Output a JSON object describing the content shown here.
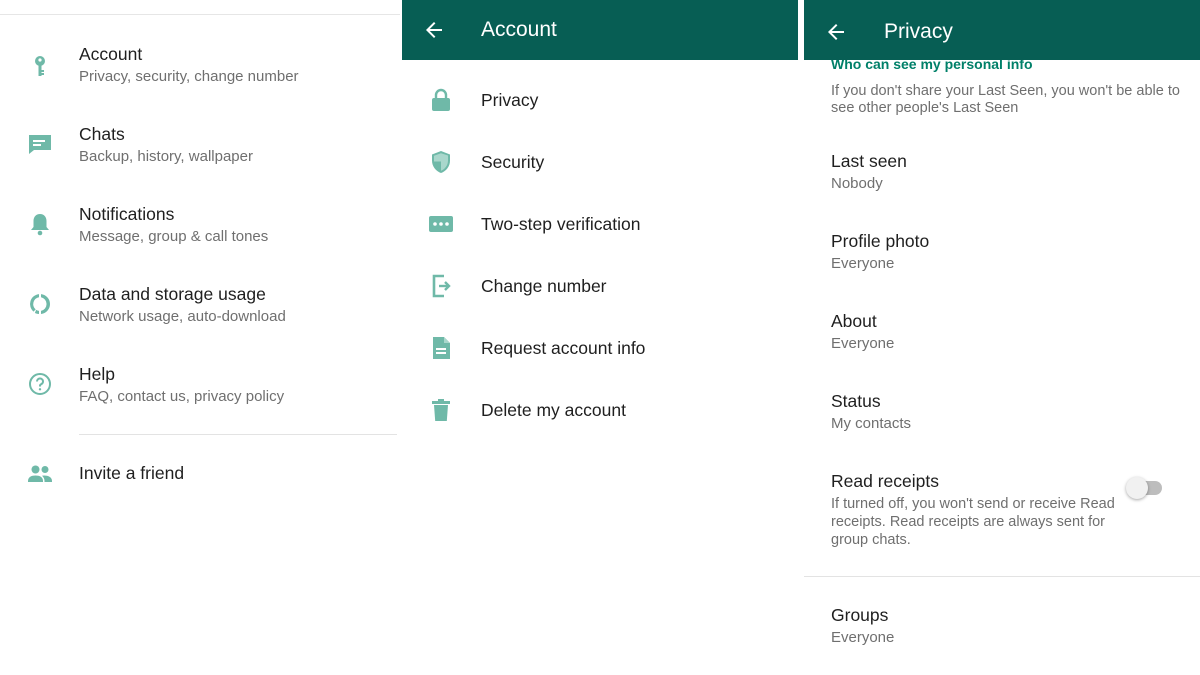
{
  "colors": {
    "accent": "#008069",
    "icon_gray_green": "#6fb9a8",
    "appbar": "#075e54",
    "toggle_off": "#bdbdbd"
  },
  "settings": {
    "items": [
      {
        "title": "Account",
        "subtitle": "Privacy, security, change number",
        "icon": "key-icon"
      },
      {
        "title": "Chats",
        "subtitle": "Backup, history, wallpaper",
        "icon": "chat-icon"
      },
      {
        "title": "Notifications",
        "subtitle": "Message, group & call tones",
        "icon": "bell-icon"
      },
      {
        "title": "Data and storage usage",
        "subtitle": "Network usage, auto-download",
        "icon": "data-usage-icon"
      },
      {
        "title": "Help",
        "subtitle": "FAQ, contact us, privacy policy",
        "icon": "help-icon"
      }
    ],
    "invite": {
      "title": "Invite a friend",
      "icon": "people-icon"
    }
  },
  "account": {
    "title": "Account",
    "back_icon": "back-arrow-icon",
    "items": [
      {
        "label": "Privacy",
        "icon": "lock-icon"
      },
      {
        "label": "Security",
        "icon": "shield-icon"
      },
      {
        "label": "Two-step verification",
        "icon": "dots-icon"
      },
      {
        "label": "Change number",
        "icon": "change-number-icon"
      },
      {
        "label": "Request account info",
        "icon": "document-icon"
      },
      {
        "label": "Delete my account",
        "icon": "trash-icon"
      }
    ]
  },
  "privacy": {
    "title": "Privacy",
    "back_icon": "back-arrow-icon",
    "section_header": "Who can see my personal info",
    "note": "If you don't share your Last Seen, you won't be able to see other people's Last Seen",
    "items": [
      {
        "title": "Last seen",
        "value": "Nobody"
      },
      {
        "title": "Profile photo",
        "value": "Everyone"
      },
      {
        "title": "About",
        "value": "Everyone"
      },
      {
        "title": "Status",
        "value": "My contacts"
      }
    ],
    "read_receipts": {
      "title": "Read receipts",
      "description": "If turned off, you won't send or receive Read receipts. Read receipts are always sent for group chats.",
      "enabled": false
    },
    "groups": {
      "title": "Groups",
      "value": "Everyone"
    }
  }
}
